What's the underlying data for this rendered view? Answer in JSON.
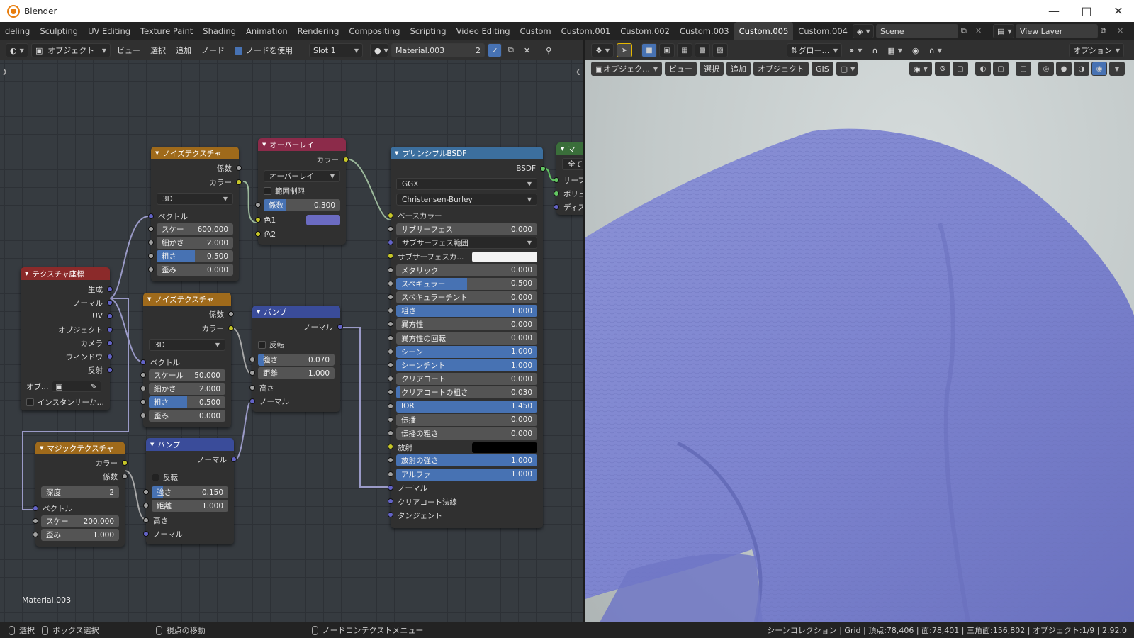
{
  "window": {
    "title": "Blender"
  },
  "workspaces": [
    "deling",
    "Sculpting",
    "UV Editing",
    "Texture Paint",
    "Shading",
    "Animation",
    "Rendering",
    "Compositing",
    "Scripting",
    "Video Editing",
    "Custom",
    "Custom.001",
    "Custom.002",
    "Custom.003",
    "Custom.005",
    "Custom.004"
  ],
  "scene": "Scene",
  "view_layer": "View Layer",
  "node_header": {
    "mode": "オブジェクト",
    "view": "ビュー",
    "select": "選択",
    "add": "追加",
    "node": "ノード",
    "use_nodes": "ノードを使用",
    "slot": "Slot 1",
    "material": "Material.003",
    "users": "2"
  },
  "vp_header": {
    "transform": "グロー…",
    "options": "オプション",
    "mode": "オブジェク…",
    "view": "ビュー",
    "select": "選択",
    "add": "追加",
    "object": "オブジェクト",
    "gis": "GIS"
  },
  "material_label": "Material.003",
  "nodes": {
    "texcoord": {
      "title": "テクスチャ座標",
      "outs": [
        "生成",
        "ノーマル",
        "UV",
        "オブジェクト",
        "カメラ",
        "ウィンドウ",
        "反射"
      ],
      "obj": "オブ…",
      "instancer": "インスタンサーか…"
    },
    "noise1": {
      "title": "ノイズテクスチャ",
      "fac": "係数",
      "color": "カラー",
      "dim": "3D",
      "vector": "ベクトル",
      "scale_l": "スケー",
      "scale": "600.000",
      "detail_l": "細かさ",
      "detail": "2.000",
      "rough_l": "粗さ",
      "rough": "0.500",
      "rough_v": 0.5,
      "dist_l": "歪み",
      "dist": "0.000"
    },
    "noise2": {
      "title": "ノイズテクスチャ",
      "fac": "係数",
      "color": "カラー",
      "dim": "3D",
      "vector": "ベクトル",
      "scale_l": "スケール",
      "scale": "50.000",
      "detail_l": "細かさ",
      "detail": "2.000",
      "rough_l": "粗さ",
      "rough": "0.500",
      "rough_v": 0.5,
      "dist_l": "歪み",
      "dist": "0.000"
    },
    "overlay": {
      "title": "オーバーレイ",
      "color": "カラー",
      "blend": "オーバーレイ",
      "clamp": "範囲制限",
      "fac_l": "係数",
      "fac": "0.300",
      "fac_v": 0.3,
      "c1": "色1",
      "c2": "色2",
      "c1_color": "#6b6bc2"
    },
    "bump1": {
      "title": "バンプ",
      "normal": "ノーマル",
      "invert": "反転",
      "str_l": "強さ",
      "str": "0.070",
      "str_v": 0.07,
      "dist_l": "距離",
      "dist": "1.000",
      "height": "高さ",
      "normal_in": "ノーマル"
    },
    "bump2": {
      "title": "バンプ",
      "normal": "ノーマル",
      "invert": "反転",
      "str_l": "強さ",
      "str": "0.150",
      "str_v": 0.15,
      "dist_l": "距離",
      "dist": "1.000",
      "height": "高さ",
      "normal_in": "ノーマル"
    },
    "magic": {
      "title": "マジックテクスチャ",
      "color": "カラー",
      "fac": "係数",
      "depth_l": "深度",
      "depth": "2",
      "vector": "ベクトル",
      "scale_l": "スケー",
      "scale": "200.000",
      "dist_l": "歪み",
      "dist": "1.000"
    },
    "bsdf": {
      "title": "プリンシプルBSDF",
      "out": "BSDF",
      "dist": "GGX",
      "sss": "Christensen-Burley",
      "base": "ベースカラー",
      "rows": [
        {
          "label": "サブサーフェス",
          "value": "0.000",
          "fill": 0
        },
        {
          "label": "サブサーフェス範囲",
          "value": "",
          "fill": 0
        },
        {
          "label": "サブサーフェスカ...",
          "value": "",
          "fill": 0
        },
        {
          "label": "メタリック",
          "value": "0.000",
          "fill": 0
        },
        {
          "label": "スペキュラー",
          "value": "0.500",
          "fill": 0.5
        },
        {
          "label": "スペキュラーチント",
          "value": "0.000",
          "fill": 0
        },
        {
          "label": "粗さ",
          "value": "1.000",
          "fill": 1
        },
        {
          "label": "異方性",
          "value": "0.000",
          "fill": 0
        },
        {
          "label": "異方性の回転",
          "value": "0.000",
          "fill": 0
        },
        {
          "label": "シーン",
          "value": "1.000",
          "fill": 1
        },
        {
          "label": "シーンチント",
          "value": "1.000",
          "fill": 1
        },
        {
          "label": "クリアコート",
          "value": "0.000",
          "fill": 0
        },
        {
          "label": "クリアコートの粗さ",
          "value": "0.030",
          "fill": 0.03
        },
        {
          "label": "IOR",
          "value": "1.450",
          "fill": 1
        },
        {
          "label": "伝播",
          "value": "0.000",
          "fill": 0
        },
        {
          "label": "伝播の粗さ",
          "value": "0.000",
          "fill": 0
        },
        {
          "label": "放射",
          "value": "",
          "fill": 0
        },
        {
          "label": "放射の強さ",
          "value": "1.000",
          "fill": 1
        },
        {
          "label": "アルファ",
          "value": "1.000",
          "fill": 1
        },
        {
          "label": "ノーマル",
          "value": "",
          "fill": 0
        },
        {
          "label": "クリアコート法線",
          "value": "",
          "fill": 0
        },
        {
          "label": "タンジェント",
          "value": "",
          "fill": 0
        }
      ]
    },
    "output": {
      "title": "マ",
      "all": "全て",
      "surface": "サーフ",
      "volume": "ボリュ",
      "disp": "ディス"
    }
  },
  "status": {
    "select": "選択",
    "box": "ボックス選択",
    "pan": "視点の移動",
    "ctx": "ノードコンテクストメニュー",
    "info": "シーンコレクション | Grid | 頂点:78,406 | 面:78,401 | 三角面:156,802 | オブジェクト:1/9 | 2.92.0"
  }
}
